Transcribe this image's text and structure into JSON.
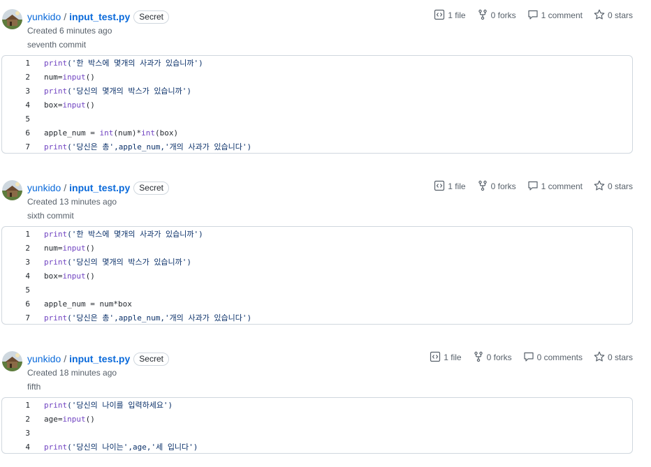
{
  "gists": [
    {
      "owner": "yunkido",
      "separator": "/",
      "filename": "input_test.py",
      "visibility": "Secret",
      "created": "Created 6 minutes ago",
      "description": "seventh commit",
      "stats": {
        "files": "1 file",
        "forks": "0 forks",
        "comments": "1 comment",
        "stars": "0 stars"
      },
      "lines": [
        {
          "num": "1",
          "tokens": [
            {
              "t": "print",
              "c": "fn"
            },
            {
              "t": "('한 박스에 몇개의 사과가 있습니까')",
              "c": "str"
            }
          ]
        },
        {
          "num": "2",
          "tokens": [
            {
              "t": "num=",
              "c": "plain"
            },
            {
              "t": "input",
              "c": "fn"
            },
            {
              "t": "()",
              "c": "plain"
            }
          ]
        },
        {
          "num": "3",
          "tokens": [
            {
              "t": "print",
              "c": "fn"
            },
            {
              "t": "('당신의 몇개의 박스가 있습니까')",
              "c": "str"
            }
          ]
        },
        {
          "num": "4",
          "tokens": [
            {
              "t": "box=",
              "c": "plain"
            },
            {
              "t": "input",
              "c": "fn"
            },
            {
              "t": "()",
              "c": "plain"
            }
          ]
        },
        {
          "num": "5",
          "tokens": []
        },
        {
          "num": "6",
          "tokens": [
            {
              "t": "apple_num = ",
              "c": "plain"
            },
            {
              "t": "int",
              "c": "fn"
            },
            {
              "t": "(num)*",
              "c": "plain"
            },
            {
              "t": "int",
              "c": "fn"
            },
            {
              "t": "(box)",
              "c": "plain"
            }
          ]
        },
        {
          "num": "7",
          "tokens": [
            {
              "t": "print",
              "c": "fn"
            },
            {
              "t": "('당신은 총',apple_num,'개의 사과가 있습니다')",
              "c": "str"
            }
          ]
        }
      ]
    },
    {
      "owner": "yunkido",
      "separator": "/",
      "filename": "input_test.py",
      "visibility": "Secret",
      "created": "Created 13 minutes ago",
      "description": "sixth commit",
      "stats": {
        "files": "1 file",
        "forks": "0 forks",
        "comments": "1 comment",
        "stars": "0 stars"
      },
      "lines": [
        {
          "num": "1",
          "tokens": [
            {
              "t": "print",
              "c": "fn"
            },
            {
              "t": "('한 박스에 몇개의 사과가 있습니까')",
              "c": "str"
            }
          ]
        },
        {
          "num": "2",
          "tokens": [
            {
              "t": "num=",
              "c": "plain"
            },
            {
              "t": "input",
              "c": "fn"
            },
            {
              "t": "()",
              "c": "plain"
            }
          ]
        },
        {
          "num": "3",
          "tokens": [
            {
              "t": "print",
              "c": "fn"
            },
            {
              "t": "('당신의 몇개의 박스가 있습니까')",
              "c": "str"
            }
          ]
        },
        {
          "num": "4",
          "tokens": [
            {
              "t": "box=",
              "c": "plain"
            },
            {
              "t": "input",
              "c": "fn"
            },
            {
              "t": "()",
              "c": "plain"
            }
          ]
        },
        {
          "num": "5",
          "tokens": []
        },
        {
          "num": "6",
          "tokens": [
            {
              "t": "apple_num = num*box",
              "c": "plain"
            }
          ]
        },
        {
          "num": "7",
          "tokens": [
            {
              "t": "print",
              "c": "fn"
            },
            {
              "t": "('당신은 총',apple_num,'개의 사과가 있습니다')",
              "c": "str"
            }
          ]
        }
      ]
    },
    {
      "owner": "yunkido",
      "separator": "/",
      "filename": "input_test.py",
      "visibility": "Secret",
      "created": "Created 18 minutes ago",
      "description": "fifth",
      "stats": {
        "files": "1 file",
        "forks": "0 forks",
        "comments": "0 comments",
        "stars": "0 stars"
      },
      "lines": [
        {
          "num": "1",
          "tokens": [
            {
              "t": "print",
              "c": "fn"
            },
            {
              "t": "('당신의 나이를 입력하세요')",
              "c": "str"
            }
          ]
        },
        {
          "num": "2",
          "tokens": [
            {
              "t": "age=",
              "c": "plain"
            },
            {
              "t": "input",
              "c": "fn"
            },
            {
              "t": "()",
              "c": "plain"
            }
          ]
        },
        {
          "num": "3",
          "tokens": []
        },
        {
          "num": "4",
          "tokens": [
            {
              "t": "print",
              "c": "fn"
            },
            {
              "t": "('당신의 나이는',age,'세 입니다')",
              "c": "str"
            }
          ]
        }
      ]
    }
  ],
  "colors": {
    "link": "#0969da",
    "muted": "#57606a",
    "keyword": "#6f42c1",
    "string": "#0a3069",
    "border": "#d0d7de"
  },
  "icons": {
    "files": "code-square-icon",
    "forks": "repo-forked-icon",
    "comments": "comment-icon",
    "stars": "star-icon"
  }
}
